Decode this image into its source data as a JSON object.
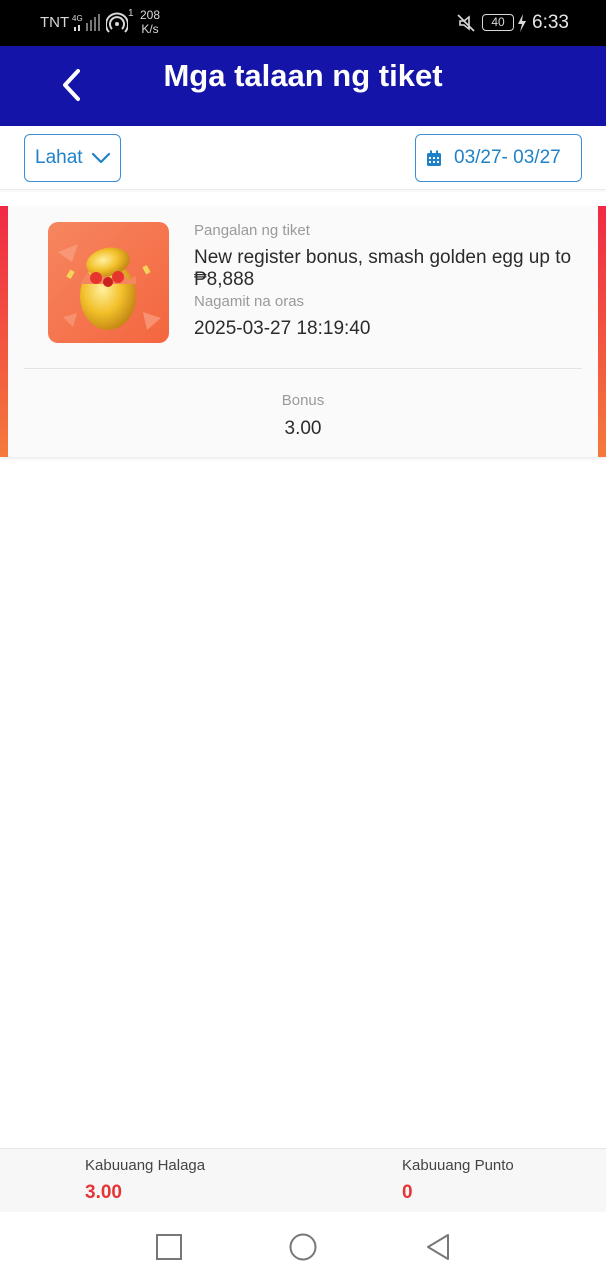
{
  "status_bar": {
    "carrier": "TNT",
    "network": "4G",
    "hotspot_count": "1",
    "speed_value": "208",
    "speed_unit": "K/s",
    "battery": "40",
    "time": "6:33"
  },
  "header": {
    "title": "Mga talaan ng tiket",
    "back_icon": "chevron-left-icon"
  },
  "filter": {
    "type_selected": "Lahat",
    "date_range": "03/27- 03/27"
  },
  "records": [
    {
      "name_label": "Pangalan ng tiket",
      "name": "New register bonus, smash golden egg up to ₱8,888",
      "used_label": "Nagamit na oras",
      "used_time": "2025-03-27 18:19:40",
      "bonus_label": "Bonus",
      "bonus_value": "3.00",
      "image_icon": "golden-egg-icon"
    }
  ],
  "summary": {
    "total_amount_label": "Kabuuang Halaga",
    "total_amount_value": "3.00",
    "total_points_label": "Kabuuang Punto",
    "total_points_value": "0"
  },
  "colors": {
    "header_bg": "#1414a8",
    "accent_blue": "#1f82c9",
    "accent_red": "#e53535",
    "card_accent": "#f02a44"
  }
}
